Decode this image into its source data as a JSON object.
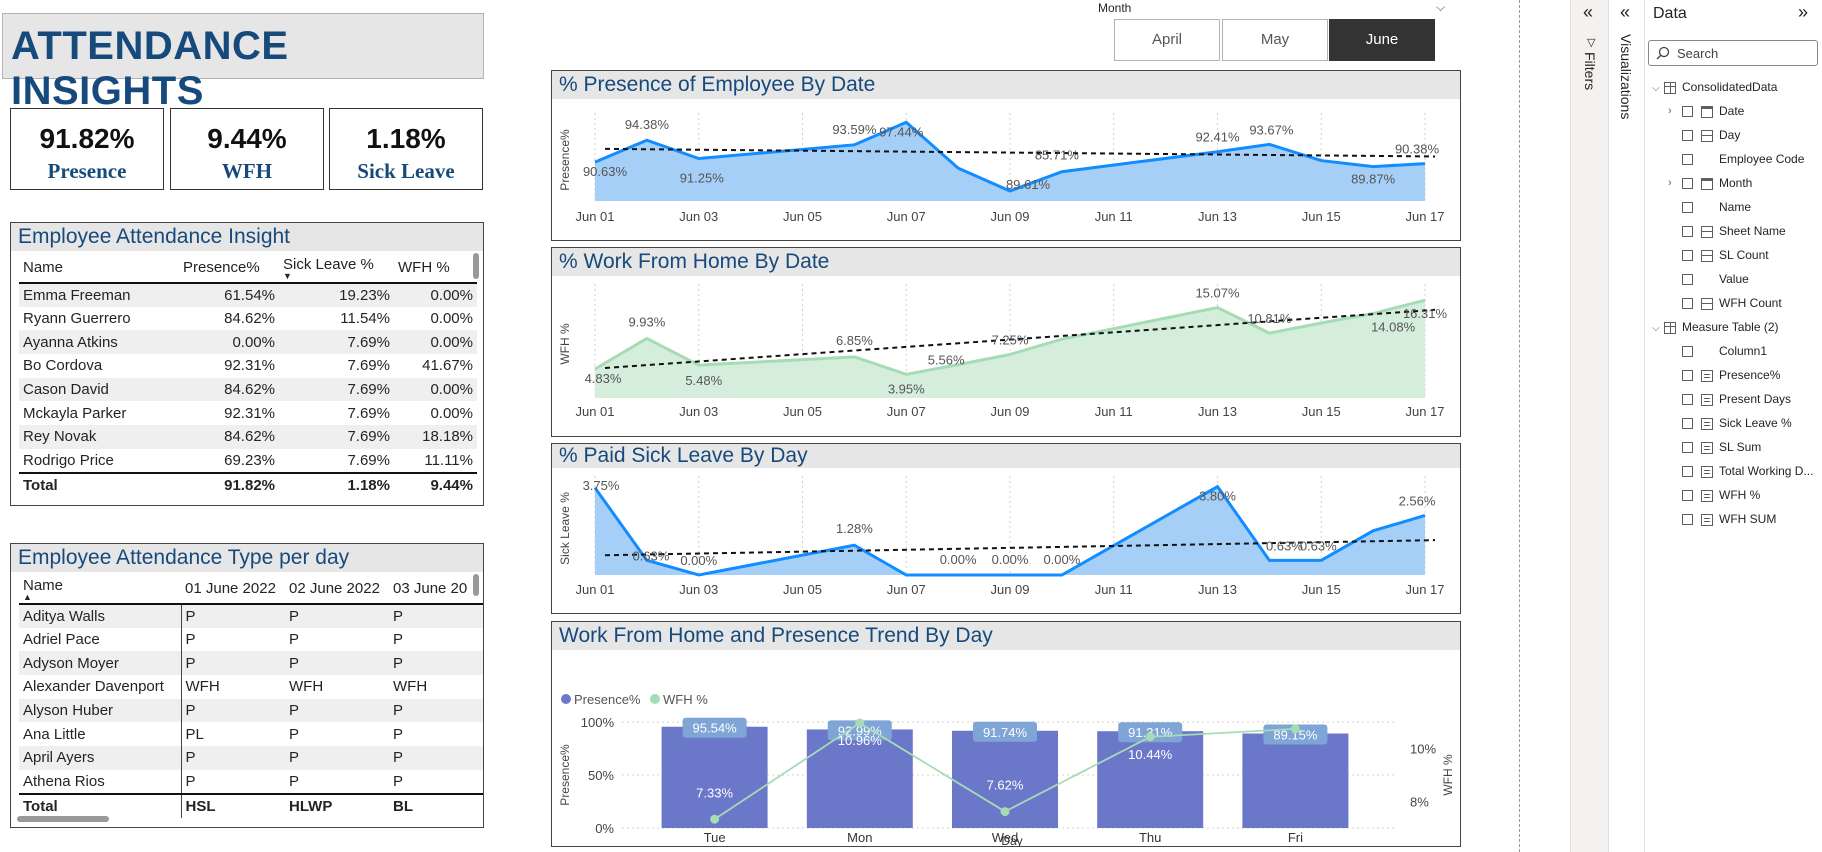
{
  "title": "ATTENDANCE INSIGHTS",
  "kpis": [
    {
      "value": "91.82%",
      "label": "Presence"
    },
    {
      "value": "9.44%",
      "label": "WFH"
    },
    {
      "value": "1.18%",
      "label": "Sick Leave"
    }
  ],
  "month_slicer": {
    "label": "Month",
    "options": [
      "April",
      "May",
      "June"
    ],
    "selected": "June"
  },
  "insight_table": {
    "title": "Employee Attendance Insight",
    "columns": [
      "Name",
      "Presence%",
      "Sick Leave %",
      "WFH %"
    ],
    "sorted_column": "Sick Leave %",
    "rows": [
      [
        "Emma Freeman",
        "61.54%",
        "19.23%",
        "0.00%"
      ],
      [
        "Ryann Guerrero",
        "84.62%",
        "11.54%",
        "0.00%"
      ],
      [
        "Ayanna Atkins",
        "0.00%",
        "7.69%",
        "0.00%"
      ],
      [
        "Bo Cordova",
        "92.31%",
        "7.69%",
        "41.67%"
      ],
      [
        "Cason David",
        "84.62%",
        "7.69%",
        "0.00%"
      ],
      [
        "Mckayla Parker",
        "92.31%",
        "7.69%",
        "0.00%"
      ],
      [
        "Rey Novak",
        "84.62%",
        "7.69%",
        "18.18%"
      ],
      [
        "Rodrigo Price",
        "69.23%",
        "7.69%",
        "11.11%"
      ]
    ],
    "total": [
      "Total",
      "91.82%",
      "1.18%",
      "9.44%"
    ]
  },
  "type_table": {
    "title": "Employee Attendance Type per day",
    "columns": [
      "Name",
      "01 June 2022",
      "02 June 2022",
      "03 June 20"
    ],
    "sorted_column": "Name",
    "rows": [
      [
        "Aditya Walls",
        "P",
        "P",
        "P"
      ],
      [
        "Adriel Pace",
        "P",
        "P",
        "P"
      ],
      [
        "Adyson Moyer",
        "P",
        "P",
        "P"
      ],
      [
        "Alexander Davenport",
        "WFH",
        "WFH",
        "WFH"
      ],
      [
        "Alyson Huber",
        "P",
        "P",
        "P"
      ],
      [
        "Ana Little",
        "PL",
        "P",
        "P"
      ],
      [
        "April Ayers",
        "P",
        "P",
        "P"
      ],
      [
        "Athena Rios",
        "P",
        "P",
        "P"
      ]
    ],
    "total": [
      "Total",
      "HSL",
      "HLWP",
      "BL"
    ]
  },
  "chart_data": [
    {
      "type": "area",
      "title": "% Presence of Employee By Date",
      "ylabel": "Presence%",
      "xlabel": "",
      "x_ticks": [
        "Jun 01",
        "Jun 03",
        "Jun 05",
        "Jun 07",
        "Jun 09",
        "Jun 11",
        "Jun 13",
        "Jun 15",
        "Jun 17"
      ],
      "x": [
        "Jun 01",
        "Jun 02",
        "Jun 03",
        "Jun 06",
        "Jun 07",
        "Jun 08",
        "Jun 09",
        "Jun 10",
        "Jun 13",
        "Jun 14",
        "Jun 15",
        "Jun 16",
        "Jun 17"
      ],
      "values": [
        90.63,
        94.38,
        91.25,
        93.59,
        97.44,
        89.61,
        85.71,
        89.0,
        92.41,
        93.67,
        90.9,
        89.87,
        90.38
      ],
      "data_labels": [
        {
          "x": "Jun 01",
          "text": "90.63%"
        },
        {
          "x": "Jun 02",
          "text": "94.38%"
        },
        {
          "x": "Jun 03",
          "text": "91.25%"
        },
        {
          "x": "Jun 06",
          "text": "93.59%"
        },
        {
          "x": "Jun 07",
          "text": "97.44%"
        },
        {
          "x": "Jun 09",
          "text": "89.61%"
        },
        {
          "x": "Jun 10",
          "text": "85.71%"
        },
        {
          "x": "Jun 13",
          "text": "92.41%"
        },
        {
          "x": "Jun 14",
          "text": "93.67%"
        },
        {
          "x": "Jun 16",
          "text": "89.87%"
        },
        {
          "x": "Jun 17",
          "text": "90.38%"
        }
      ],
      "trend": [
        92.9,
        91.6
      ],
      "ylim": [
        84,
        98
      ],
      "color": "#118dff"
    },
    {
      "type": "area",
      "title": "% Work From Home By Date",
      "ylabel": "WFH %",
      "xlabel": "",
      "x_ticks": [
        "Jun 01",
        "Jun 03",
        "Jun 05",
        "Jun 07",
        "Jun 09",
        "Jun 11",
        "Jun 13",
        "Jun 15",
        "Jun 17"
      ],
      "x": [
        "Jun 01",
        "Jun 02",
        "Jun 03",
        "Jun 06",
        "Jun 07",
        "Jun 08",
        "Jun 09",
        "Jun 10",
        "Jun 13",
        "Jun 14",
        "Jun 15",
        "Jun 16",
        "Jun 17"
      ],
      "values": [
        4.83,
        9.93,
        5.48,
        6.85,
        3.95,
        5.56,
        7.25,
        9.8,
        15.07,
        10.81,
        12.5,
        14.08,
        16.31
      ],
      "data_labels": [
        {
          "x": "Jun 01",
          "text": "4.83%"
        },
        {
          "x": "Jun 02",
          "text": "9.93%"
        },
        {
          "x": "Jun 03",
          "text": "5.48%"
        },
        {
          "x": "Jun 06",
          "text": "6.85%"
        },
        {
          "x": "Jun 07",
          "text": "3.95%"
        },
        {
          "x": "Jun 08",
          "text": "5.56%"
        },
        {
          "x": "Jun 09",
          "text": "7.25%"
        },
        {
          "x": "Jun 13",
          "text": "15.07%"
        },
        {
          "x": "Jun 14",
          "text": "10.81%"
        },
        {
          "x": "Jun 16",
          "text": "14.08%"
        },
        {
          "x": "Jun 17",
          "text": "16.31%"
        }
      ],
      "trend": [
        5.0,
        14.7
      ],
      "ylim": [
        0,
        18
      ],
      "color": "#a6dcb5"
    },
    {
      "type": "area",
      "title": "% Paid Sick Leave By Day",
      "ylabel": "Sick Leave %",
      "xlabel": "",
      "x_ticks": [
        "Jun 01",
        "Jun 03",
        "Jun 05",
        "Jun 07",
        "Jun 09",
        "Jun 11",
        "Jun 13",
        "Jun 15",
        "Jun 17"
      ],
      "x": [
        "Jun 01",
        "Jun 02",
        "Jun 03",
        "Jun 06",
        "Jun 07",
        "Jun 08",
        "Jun 09",
        "Jun 10",
        "Jun 13",
        "Jun 14",
        "Jun 15",
        "Jun 16",
        "Jun 17"
      ],
      "values": [
        3.75,
        0.63,
        0.0,
        1.28,
        0.0,
        0.0,
        0.0,
        0.0,
        3.8,
        0.63,
        0.63,
        1.9,
        2.56
      ],
      "data_labels": [
        {
          "x": "Jun 01",
          "text": "3.75%"
        },
        {
          "x": "Jun 02",
          "text": "0.63%"
        },
        {
          "x": "Jun 03",
          "text": "0.00%"
        },
        {
          "x": "Jun 06",
          "text": "1.28%"
        },
        {
          "x": "Jun 08",
          "text": "0.00%"
        },
        {
          "x": "Jun 09",
          "text": "0.00%"
        },
        {
          "x": "Jun 10",
          "text": "0.00%"
        },
        {
          "x": "Jun 13",
          "text": "3.80%"
        },
        {
          "x": "Jun 14",
          "text": "0.63%"
        },
        {
          "x": "Jun 15",
          "text": "0.63%"
        },
        {
          "x": "Jun 17",
          "text": "2.56%"
        }
      ],
      "trend": [
        0.85,
        1.5
      ],
      "ylim": [
        0,
        4
      ],
      "color": "#118dff"
    },
    {
      "type": "bar",
      "title": "Work From Home and Presence Trend By Day",
      "xlabel": "Day",
      "ylabel": "Presence%",
      "y2label": "WFH %",
      "categories": [
        "Tue",
        "Mon",
        "Wed",
        "Thu",
        "Fri"
      ],
      "series": [
        {
          "name": "Presence%",
          "kind": "bar",
          "values": [
            95.54,
            92.99,
            91.74,
            91.31,
            89.15
          ],
          "labels": [
            "95.54%",
            "92.99%",
            "91.74%",
            "91.31%",
            "89.15%"
          ],
          "color": "#6b77c9"
        },
        {
          "name": "WFH %",
          "kind": "line",
          "values": [
            7.33,
            10.96,
            7.62,
            10.44,
            10.74
          ],
          "labels": [
            "7.33%",
            "10.96%",
            "7.62%",
            "10.44%",
            "10.74%"
          ],
          "color": "#a6dcb5"
        }
      ],
      "ylim": [
        0,
        100
      ],
      "y_ticks": [
        "0%",
        "50%",
        "100%"
      ],
      "y2lim": [
        7,
        11
      ],
      "y2_ticks": [
        "8%",
        "10%"
      ],
      "legend": "top-left"
    }
  ],
  "side": {
    "filters_label": "Filters",
    "visualizations_label": "Visualizations",
    "data_label": "Data",
    "search_placeholder": "Search",
    "tree": [
      {
        "label": "ConsolidatedData",
        "kind": "table",
        "expanded": true
      },
      {
        "label": "Date",
        "kind": "hierarchy",
        "collapsed": true
      },
      {
        "label": "Day",
        "kind": "calc"
      },
      {
        "label": "Employee Code",
        "kind": "field"
      },
      {
        "label": "Month",
        "kind": "hierarchy",
        "collapsed": true
      },
      {
        "label": "Name",
        "kind": "field"
      },
      {
        "label": "Sheet Name",
        "kind": "calc"
      },
      {
        "label": "SL Count",
        "kind": "calc"
      },
      {
        "label": "Value",
        "kind": "field"
      },
      {
        "label": "WFH Count",
        "kind": "calc"
      },
      {
        "label": "Measure Table (2)",
        "kind": "table",
        "expanded": true
      },
      {
        "label": "Column1",
        "kind": "field"
      },
      {
        "label": "Presence%",
        "kind": "measure"
      },
      {
        "label": "Present Days",
        "kind": "measure"
      },
      {
        "label": "Sick Leave %",
        "kind": "measure"
      },
      {
        "label": "SL Sum",
        "kind": "measure"
      },
      {
        "label": "Total Working D...",
        "kind": "measure"
      },
      {
        "label": "WFH %",
        "kind": "measure"
      },
      {
        "label": "WFH SUM",
        "kind": "measure"
      }
    ]
  }
}
